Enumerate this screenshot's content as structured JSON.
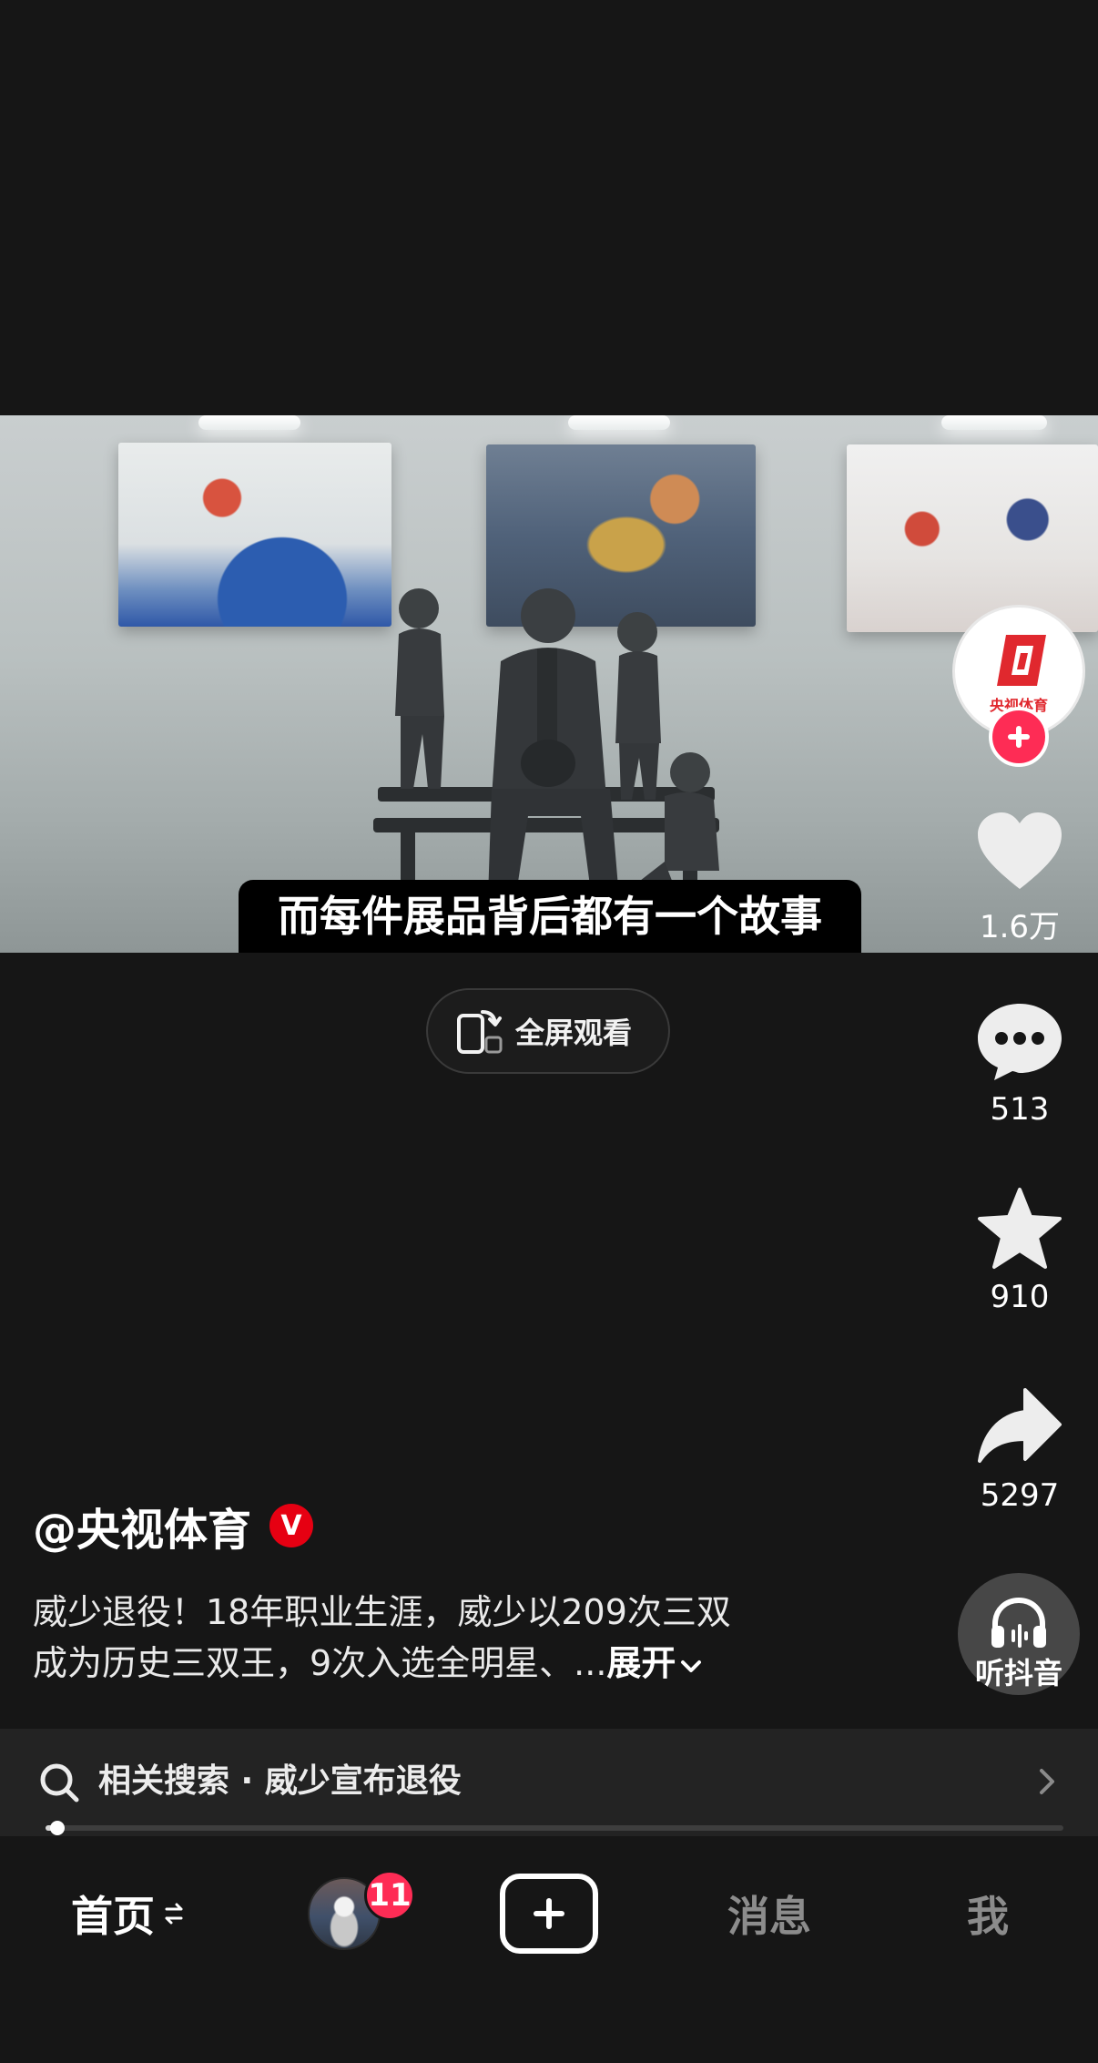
{
  "video": {
    "subtitle": "而每件展品背后都有一个故事",
    "fullscreen_label": "全屏观看"
  },
  "author": {
    "name": "@央视体育",
    "verified_badge": "V",
    "avatar_caption": "央视体育"
  },
  "rail": {
    "like_count": "1.6万",
    "comment_count": "513",
    "favorite_count": "910",
    "share_count": "5297",
    "listen_label": "听抖音"
  },
  "description": {
    "line1": "威少退役！18年职业生涯，威少以209次三双",
    "line2": "成为历史三双王，9次入选全明星、...",
    "expand_label": "展开"
  },
  "related_search": {
    "text": "相关搜索 · 威少宣布退役"
  },
  "playback": {
    "progress_fraction": 0.012
  },
  "tabbar": {
    "home": "首页",
    "friends_badge": "11",
    "messages": "消息",
    "me": "我"
  },
  "colors": {
    "accent": "#fe2c55",
    "brand_red": "#e60012",
    "background": "#161616"
  },
  "icons": [
    "fullscreen-rotate-icon",
    "heart-icon",
    "comment-icon",
    "star-icon",
    "share-icon",
    "headphones-icon",
    "search-icon",
    "chevron-right-icon",
    "chevron-down-icon",
    "plus-icon",
    "swap-icon"
  ]
}
